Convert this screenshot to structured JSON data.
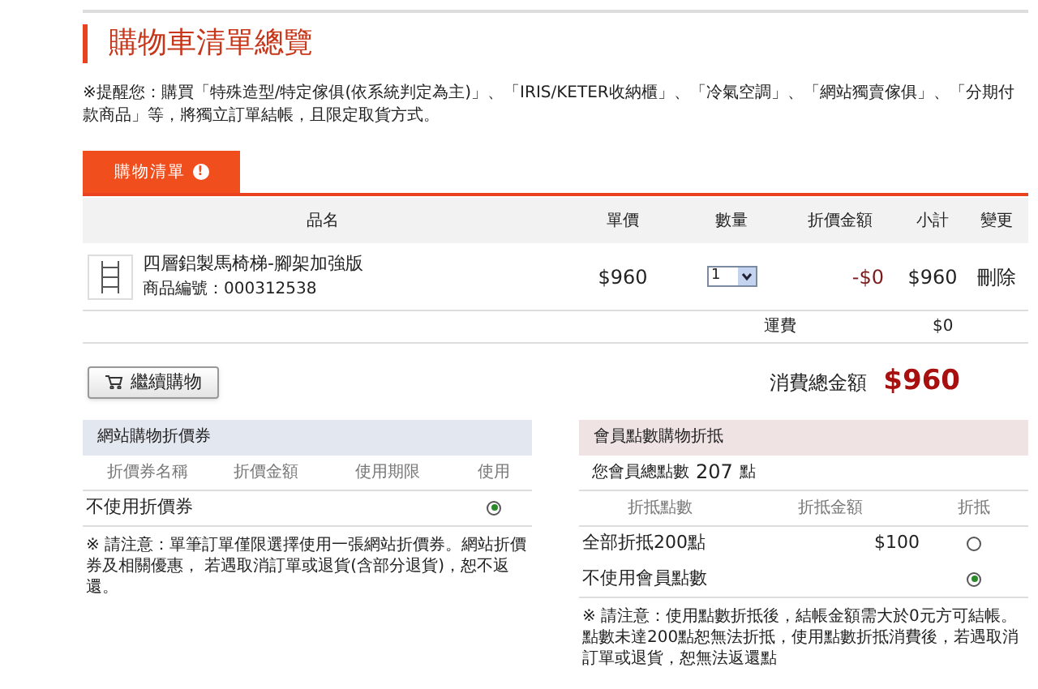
{
  "title": "購物車清單總覽",
  "notice": "※提醒您：購買「特殊造型/特定傢俱(依系統判定為主)」、「IRIS/KETER收納櫃」、「冷氣空調」、「網站獨賣傢俱」、「分期付款商品」等，將獨立訂單結帳，且限定取貨方式。",
  "tab": {
    "label": "購物清單",
    "badge": "!"
  },
  "cart": {
    "columns": [
      "品名",
      "單價",
      "數量",
      "折價金額",
      "小計",
      "變更"
    ],
    "rows": [
      {
        "name": "四層鋁製馬椅梯-腳架加強版",
        "code": "商品編號：000312538",
        "price": "$960",
        "quantity": "1",
        "discount": "-$0",
        "subtotal": "$960",
        "action": "刪除"
      }
    ],
    "shipping_label": "運費",
    "shipping": "$0"
  },
  "continue_button": "繼續購物",
  "total_label": "消費總金額",
  "total": "$960",
  "coupon": {
    "title": "網站購物折價券",
    "columns": [
      "折價券名稱",
      "折價金額",
      "使用期限",
      "使用"
    ],
    "options": [
      {
        "label": "不使用折價券",
        "selected": true
      }
    ],
    "note": "※ 請注意：單筆訂單僅限選擇使用一張網站折價券。網站折價券及相關優惠， 若遇取消訂單或退貨(含部分退貨)，恕不返還。"
  },
  "points": {
    "title": "會員點數購物折抵",
    "total_label": "您會員總點數",
    "total": "207",
    "unit": "點",
    "columns": [
      "折抵點數",
      "折抵金額",
      "折抵"
    ],
    "options": [
      {
        "label": "全部折抵200點",
        "amount": "$100",
        "selected": false
      },
      {
        "label": "不使用會員點數",
        "selected": true
      }
    ],
    "note": "※ 請注意：使用點數折抵後，結帳金額需大於0元方可結帳。點數未達200點恕無法折抵，使用點數折抵消費後，若遇取消訂單或退貨，恕無法返還點"
  }
}
